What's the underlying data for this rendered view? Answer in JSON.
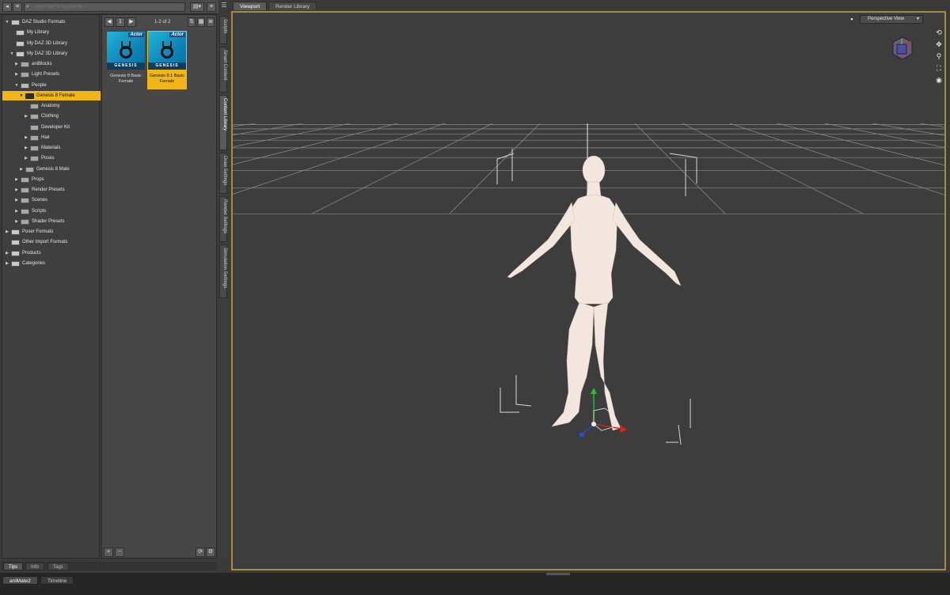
{
  "toolbar": {
    "search_placeholder": "Enter text to search by...",
    "back_glyph": "◂",
    "menu_glyph": "≡"
  },
  "tree": [
    {
      "label": "DAZ Studio Formats",
      "depth": 0,
      "arrow": "▼",
      "kind": "db"
    },
    {
      "label": "My Library",
      "depth": 1,
      "arrow": "",
      "kind": "db"
    },
    {
      "label": "My DAZ 3D Library",
      "depth": 1,
      "arrow": "",
      "kind": "db"
    },
    {
      "label": "My DAZ 3D Library",
      "depth": 1,
      "arrow": "▼",
      "kind": "db"
    },
    {
      "label": "aniBlocks",
      "depth": 2,
      "arrow": "▶",
      "kind": "folder"
    },
    {
      "label": "Light Presets",
      "depth": 2,
      "arrow": "▶",
      "kind": "folder"
    },
    {
      "label": "People",
      "depth": 2,
      "arrow": "▼",
      "kind": "open"
    },
    {
      "label": "Genesis 8 Female",
      "depth": 3,
      "arrow": "▼",
      "kind": "open",
      "selected": true
    },
    {
      "label": "Anatomy",
      "depth": 4,
      "arrow": "",
      "kind": "folder"
    },
    {
      "label": "Clothing",
      "depth": 4,
      "arrow": "▶",
      "kind": "folder"
    },
    {
      "label": "Developer Kit",
      "depth": 4,
      "arrow": "",
      "kind": "folder"
    },
    {
      "label": "Hair",
      "depth": 4,
      "arrow": "▶",
      "kind": "folder"
    },
    {
      "label": "Materials",
      "depth": 4,
      "arrow": "▶",
      "kind": "folder"
    },
    {
      "label": "Poses",
      "depth": 4,
      "arrow": "▶",
      "kind": "folder"
    },
    {
      "label": "Genesis 8 Male",
      "depth": 3,
      "arrow": "▶",
      "kind": "folder"
    },
    {
      "label": "Props",
      "depth": 2,
      "arrow": "▶",
      "kind": "folder"
    },
    {
      "label": "Render Presets",
      "depth": 2,
      "arrow": "▶",
      "kind": "folder"
    },
    {
      "label": "Scenes",
      "depth": 2,
      "arrow": "▶",
      "kind": "folder"
    },
    {
      "label": "Scripts",
      "depth": 2,
      "arrow": "▶",
      "kind": "folder"
    },
    {
      "label": "Shader Presets",
      "depth": 2,
      "arrow": "▶",
      "kind": "folder"
    },
    {
      "label": "Poser Formats",
      "depth": 0,
      "arrow": "▶",
      "kind": "db"
    },
    {
      "label": "Other Import Formats",
      "depth": 0,
      "arrow": "",
      "kind": "db"
    },
    {
      "label": "Products",
      "depth": 0,
      "arrow": "▶",
      "kind": "db"
    },
    {
      "label": "Categories",
      "depth": 0,
      "arrow": "▶",
      "kind": "db"
    }
  ],
  "content": {
    "page_info": "1-2 of 2",
    "add_label": "+",
    "remove_label": "−",
    "items": [
      {
        "name": "Genesis 8 Basic Female",
        "badge": "Actor",
        "brand": "GENESIS",
        "selected": false
      },
      {
        "name": "Genesis 8.1 Basic Female",
        "badge": "Actor",
        "brand": "GENESIS",
        "selected": true
      }
    ]
  },
  "side_tabs": [
    {
      "label": "Scripts",
      "active": false
    },
    {
      "label": "Smart Content",
      "active": false
    },
    {
      "label": "Content Library",
      "active": true
    },
    {
      "label": "Draw Settings",
      "active": false
    },
    {
      "label": "Render Settings",
      "active": false
    },
    {
      "label": "Simulation Settings",
      "active": false
    }
  ],
  "viewport": {
    "tabs": [
      {
        "label": "Viewport",
        "active": true
      },
      {
        "label": "Render Library",
        "active": false
      }
    ],
    "view_mode": "Perspective View",
    "accent_color": "#a88b3d"
  },
  "bottom_tabs": [
    {
      "label": "Tips",
      "active": true
    },
    {
      "label": "Info",
      "active": false
    },
    {
      "label": "Tags",
      "active": false
    }
  ],
  "status_tabs": [
    {
      "label": "aniMate2",
      "active": true
    },
    {
      "label": "Timeline",
      "active": false
    }
  ],
  "colors": {
    "selection": "#f2b517",
    "panel": "#3f3f3f",
    "viewport_bg": "#3d3d3d"
  }
}
